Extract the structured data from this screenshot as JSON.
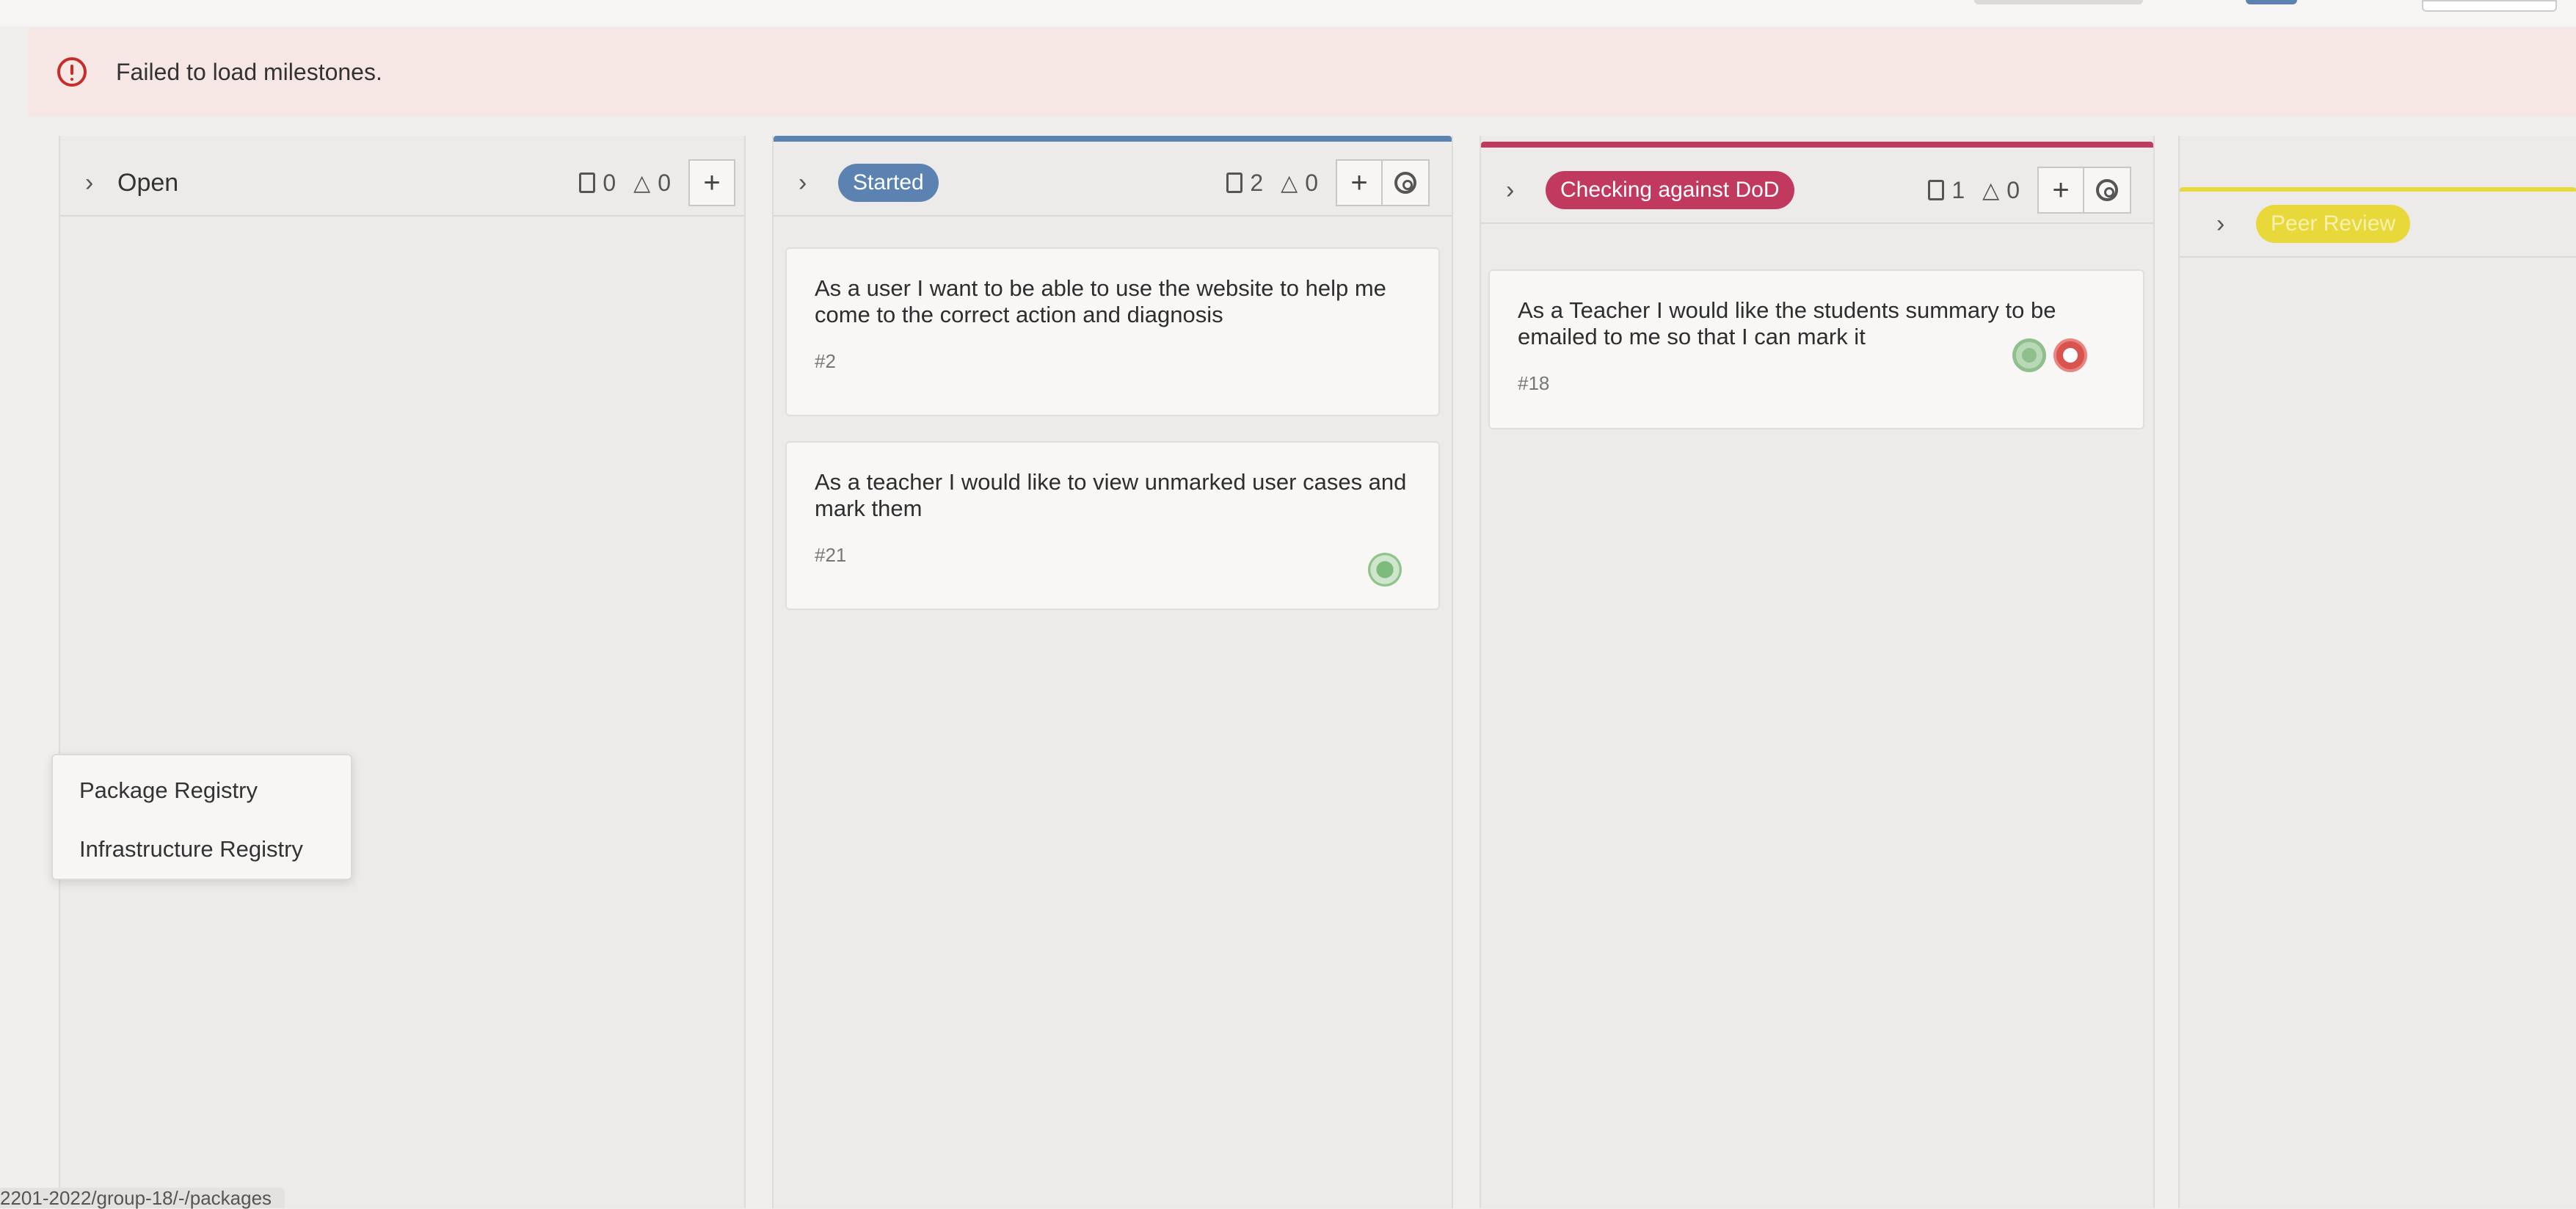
{
  "alert": {
    "text": "Failed to load milestones."
  },
  "columns": [
    {
      "title": "Open",
      "issues": "0",
      "weight": "0",
      "bar_color": ""
    },
    {
      "title": "Started",
      "issues": "2",
      "weight": "0",
      "bar_color": "#5b82b1"
    },
    {
      "title": "Checking against DoD",
      "issues": "1",
      "weight": "0",
      "bar_color": "#c1395e"
    },
    {
      "title": "Peer Review",
      "bar_color": "#e8d83a"
    }
  ],
  "cards": [
    {
      "title": "As a user I want to be able to use the website to help me come to the correct action and diagnosis",
      "id": "#2"
    },
    {
      "title": "As a teacher I would like to view unmarked user cases and mark them",
      "id": "#21"
    },
    {
      "title": "As a Teacher I would like the students summary to be emailed to me so that I can mark it",
      "id": "#18"
    }
  ],
  "dropdown": {
    "items": [
      "Package Registry",
      "Infrastructure Registry"
    ]
  },
  "status_bar": {
    "url": "2201-2022/group-18/-/packages"
  },
  "icons": {
    "alert": "exclamation-circle-icon",
    "expand": "chevron-right-icon",
    "issues": "issues-icon",
    "weight": "weight-icon",
    "add": "plus-icon",
    "settings": "gear-icon"
  }
}
